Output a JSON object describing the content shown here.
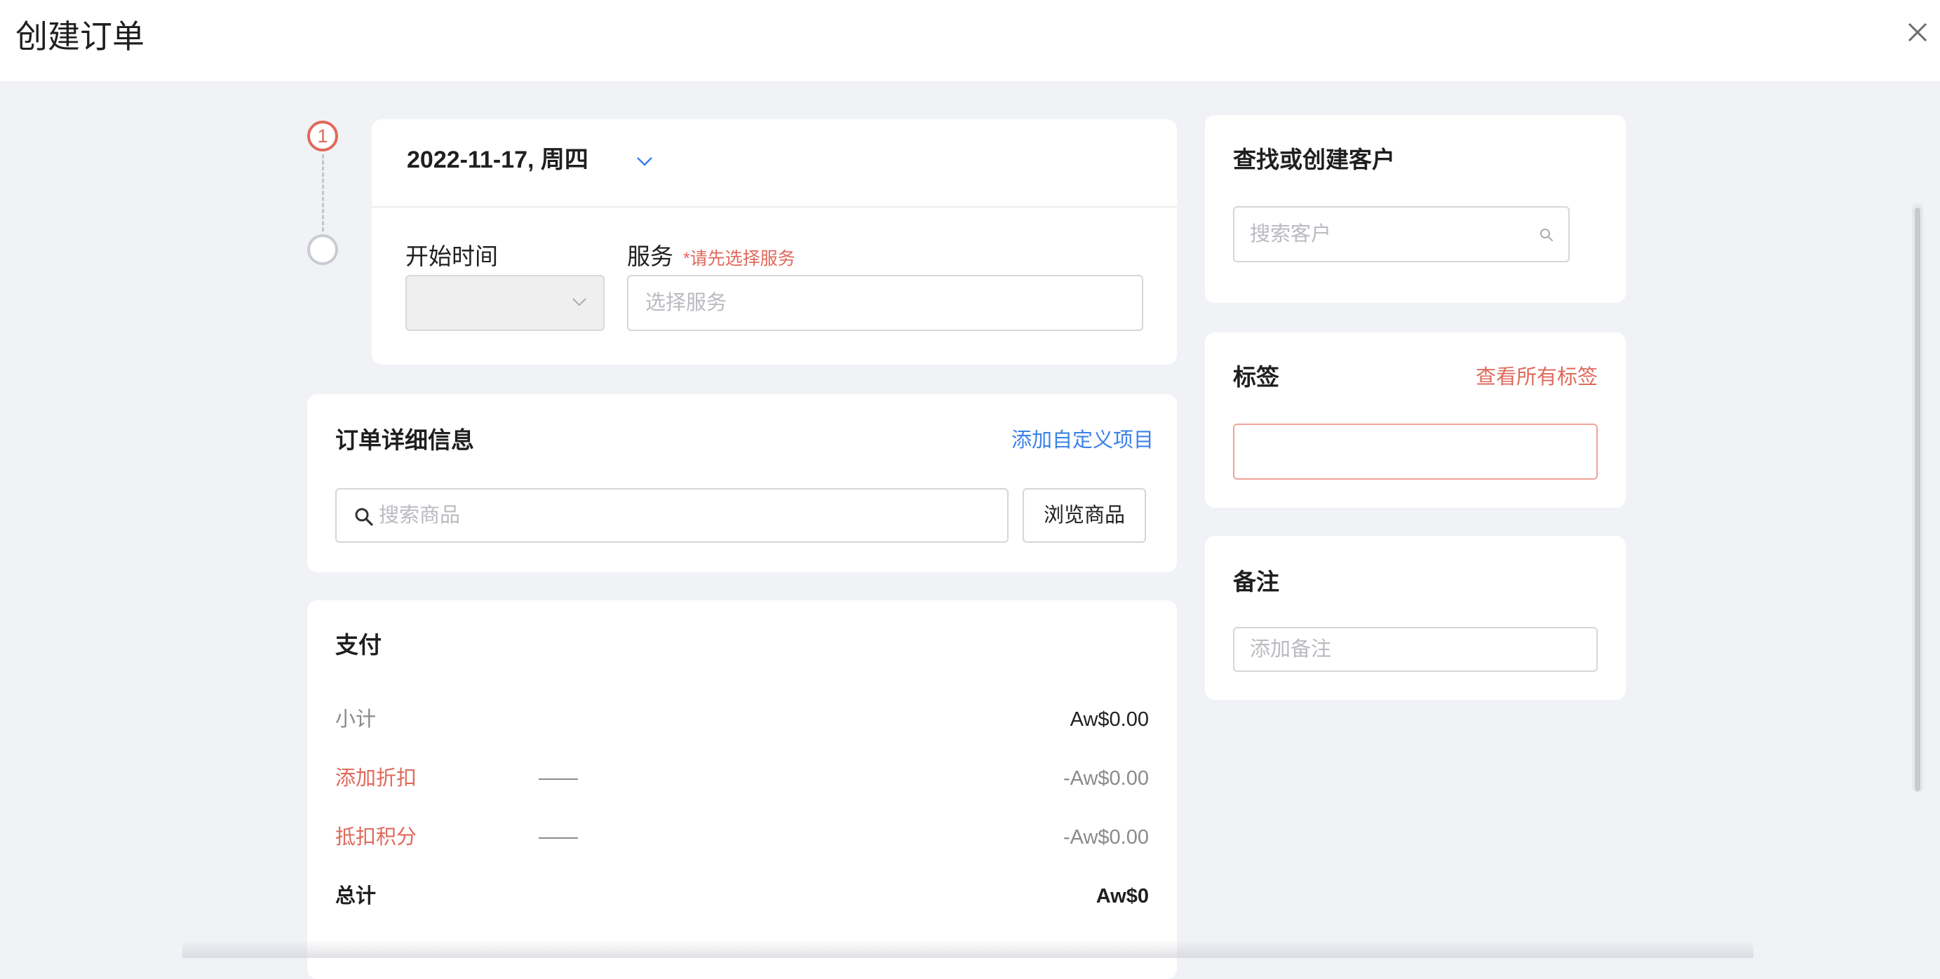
{
  "header": {
    "title": "创建订单",
    "close_icon": "close-icon"
  },
  "appointment": {
    "step_number": "1",
    "date": "2022-11-17, 周四",
    "start_time_label": "开始时间",
    "start_time_value": "",
    "service_label": "服务",
    "service_required_hint": "*请先选择服务",
    "service_placeholder": "选择服务"
  },
  "order_details": {
    "title": "订单详细信息",
    "add_custom_label": "添加自定义项目",
    "search_placeholder": "搜索商品",
    "browse_label": "浏览商品"
  },
  "payment": {
    "title": "支付",
    "subtotal_label": "小计",
    "subtotal_value": "Aw$0.00",
    "discount_label": "添加折扣",
    "discount_value": "-Aw$0.00",
    "points_label": "抵扣积分",
    "points_value": "-Aw$0.00",
    "total_label": "总计",
    "total_value": "Aw$0"
  },
  "customer": {
    "title": "查找或创建客户",
    "search_placeholder": "搜索客户"
  },
  "tags": {
    "title": "标签",
    "view_all_label": "查看所有标签"
  },
  "notes": {
    "title": "备注",
    "placeholder": "添加备注"
  },
  "colors": {
    "accent_red": "#e0695b",
    "link_blue": "#3b82e8",
    "background": "#f1f2f6"
  }
}
